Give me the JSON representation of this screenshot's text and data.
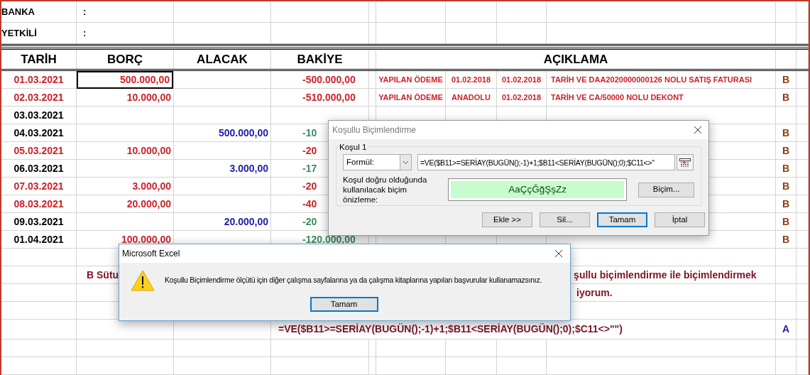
{
  "sheet": {
    "info_rows": [
      {
        "label": "BANKA",
        "value": ":"
      },
      {
        "label": "YETKİLİ",
        "value": ":"
      }
    ],
    "columns": [
      "TARİH",
      "BORÇ",
      "ALACAK",
      "BAKİYE",
      "AÇIKLAMA"
    ],
    "rows": [
      {
        "date": "01.03.2021",
        "date_flagged": true,
        "debit": "500.000,00",
        "balance": "-500.000,00",
        "balance_loss": true,
        "selected": true,
        "notes": [
          "YAPILAN ÖDEME",
          "01.02.2018",
          "01.02.2018",
          "TARİH VE DAA2020000000126 NOLU SATIŞ FATURASI"
        ],
        "mark": "B"
      },
      {
        "date": "02.03.2021",
        "date_flagged": true,
        "debit": "10.000,00",
        "balance": "-510.000,00",
        "balance_loss": true,
        "selected": false,
        "notes": [
          "YAPILAN ÖDEME",
          "ANADOLU",
          "01.02.2018",
          "TARİH VE CA/50000 NOLU DEKONT"
        ],
        "mark": "B"
      },
      {
        "date": "03.03.2021",
        "date_flagged": false,
        "selected": false
      },
      {
        "date": "04.03.2021",
        "date_flagged": false,
        "credit": "500.000,00",
        "balance": "-10",
        "balance_loss": false,
        "selected": false,
        "mark": "B"
      },
      {
        "date": "05.03.2021",
        "date_flagged": true,
        "debit": "10.000,00",
        "balance": "-20",
        "balance_loss": true,
        "selected": false,
        "mark": "B"
      },
      {
        "date": "06.03.2021",
        "date_flagged": false,
        "credit": "3.000,00",
        "balance": "-17",
        "balance_loss": false,
        "selected": false,
        "mark": "B"
      },
      {
        "date": "07.03.2021",
        "date_flagged": true,
        "debit": "3.000,00",
        "balance": "-20",
        "balance_loss": true,
        "selected": false,
        "mark": "B"
      },
      {
        "date": "08.03.2021",
        "date_flagged": true,
        "debit": "20.000,00",
        "balance": "-40",
        "balance_loss": true,
        "selected": false,
        "mark": "B"
      },
      {
        "date": "09.03.2021",
        "date_flagged": false,
        "credit": "20.000,00",
        "balance": "-20",
        "balance_loss": false,
        "selected": false,
        "mark": "B"
      },
      {
        "date": "01.04.2021",
        "date_flagged": false,
        "debit": "100.000,00",
        "balance": "-120.000,00",
        "balance_loss": false,
        "selected": false,
        "mark": "B"
      }
    ],
    "note_line_1_start": "B Sütu",
    "note_line_1_end": "şullu biçimlendirme ile biçimlendirmek",
    "note_line_2_end": "iyorum.",
    "formula": "=VE($B11>=SERİAY(BUGÜN();-1)+1;$B11<SERİAY(BUGÜN();0);$C11<>\"\")",
    "formula_mark": "A"
  },
  "format_dialog": {
    "title": "Koşullu Biçimlendirme",
    "group": "Koşul 1",
    "condition_type": "Formül:",
    "formula": "=VE($B11>=SERİAY(BUGÜN();-1)+1;$B11<SERİAY(BUGÜN();0);$C11<>\"",
    "preview_label": "Koşul doğru olduğunda kullanılacak biçim önizleme:",
    "preview": "AaÇçĞğŞşZz",
    "format_button": "Biçim...",
    "buttons": [
      {
        "label": "Ekle >>",
        "default": false
      },
      {
        "label": "Sil...",
        "default": false
      },
      {
        "label": "Tamam",
        "default": true
      },
      {
        "label": "İptal",
        "default": false
      }
    ]
  },
  "alert_dialog": {
    "title": "Microsoft Excel",
    "message": "Koşullu Biçimlendirme ölçütü için diğer çalışma sayfalarına ya da çalışma kitaplarına yapılan başvurular kullanamazsınız.",
    "button": "Tamam"
  }
}
